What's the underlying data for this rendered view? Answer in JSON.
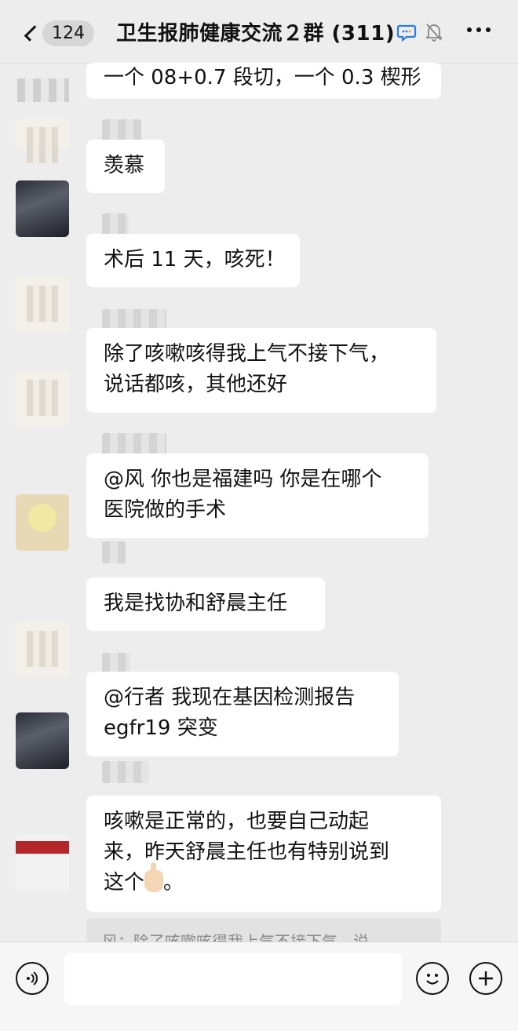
{
  "header": {
    "back_count": "124",
    "title": "卫生报肺健康交流２群 (311)",
    "chat_icon": "chat-bubble-icon",
    "mute_icon": "bell-mute-icon",
    "more_icon": "more-dots-icon"
  },
  "messages": [
    {
      "lines": [
        "一个 08+0.7 段切，一个 0.3 楔形"
      ]
    },
    {
      "lines": [
        "羡慕"
      ]
    },
    {
      "lines": [
        "术后 11 天，咳死！"
      ]
    },
    {
      "lines": [
        "除了咳嗽咳得我上气不接下气，",
        "说话都咳，其他还好"
      ]
    },
    {
      "lines": [
        "@风 你也是福建吗 你是在哪个",
        "医院做的手术"
      ]
    },
    {
      "lines": [
        "我是找协和舒晨主任"
      ]
    },
    {
      "lines": [
        "@行者 我现在基因检测报告",
        "egfr19 突变"
      ]
    },
    {
      "lines": [
        "咳嗽是正常的，也要自己动起",
        "来，昨天舒晨主任也有特别说到",
        "这个"
      ],
      "tail": "。"
    }
  ],
  "quote_text": "风：除了咳嗽咳得我上气不接下气，说",
  "bottom": {
    "voice_icon": "voice-icon",
    "emoji_icon": "emoji-icon",
    "plus_icon": "plus-icon",
    "input_value": ""
  }
}
